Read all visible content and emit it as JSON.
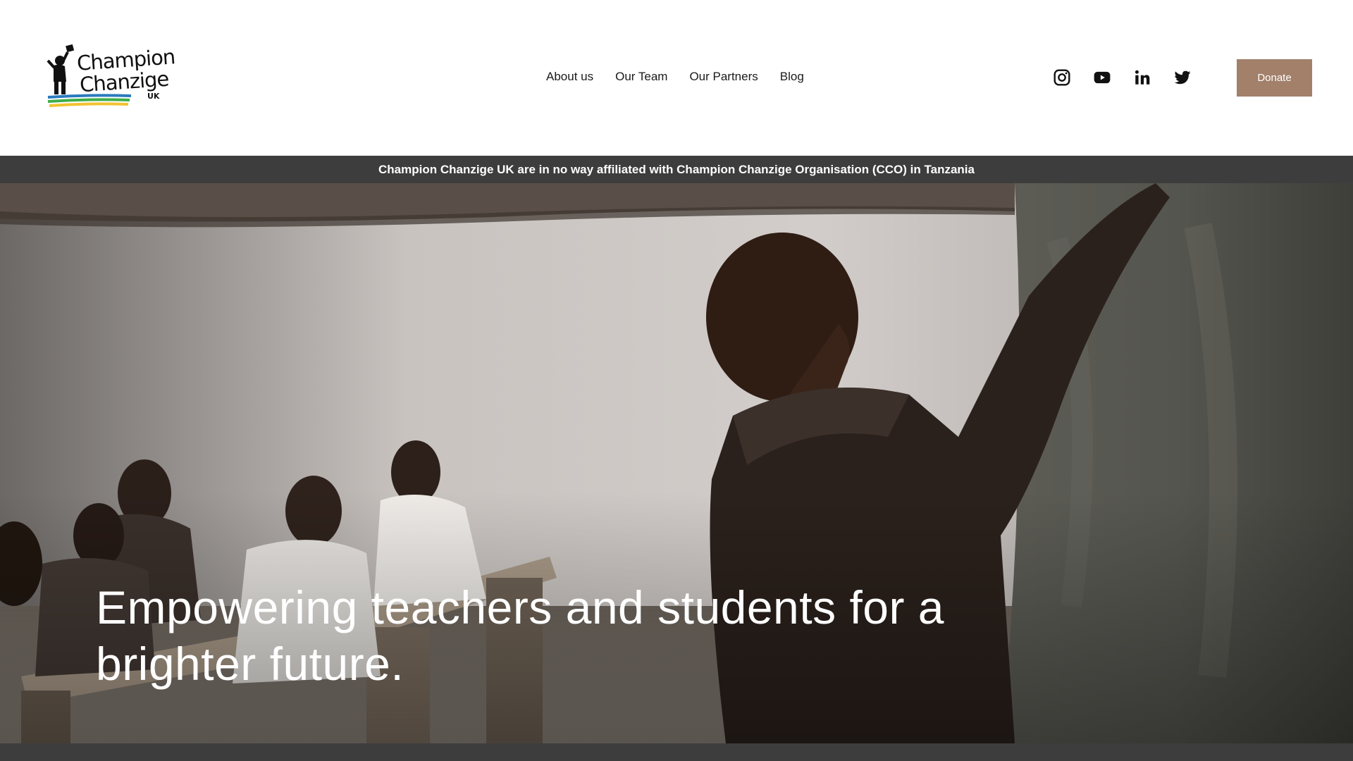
{
  "logo": {
    "line1": "Champion",
    "line2": "Chanzige",
    "sub": "UK"
  },
  "nav": {
    "items": [
      {
        "label": "About us"
      },
      {
        "label": "Our Team"
      },
      {
        "label": "Our Partners"
      },
      {
        "label": "Blog"
      }
    ]
  },
  "social": {
    "icons": [
      "instagram-icon",
      "youtube-icon",
      "linkedin-icon",
      "twitter-icon"
    ]
  },
  "donate": {
    "label": "Donate",
    "color": "#a2806a"
  },
  "announcement": {
    "text": "Champion Chanzige UK are in no way affiliated with Champion Chanzige Organisation (CCO) in Tanzania",
    "background": "#3d3d3e"
  },
  "hero": {
    "heading": "Empowering teachers and students for a brighter future."
  }
}
